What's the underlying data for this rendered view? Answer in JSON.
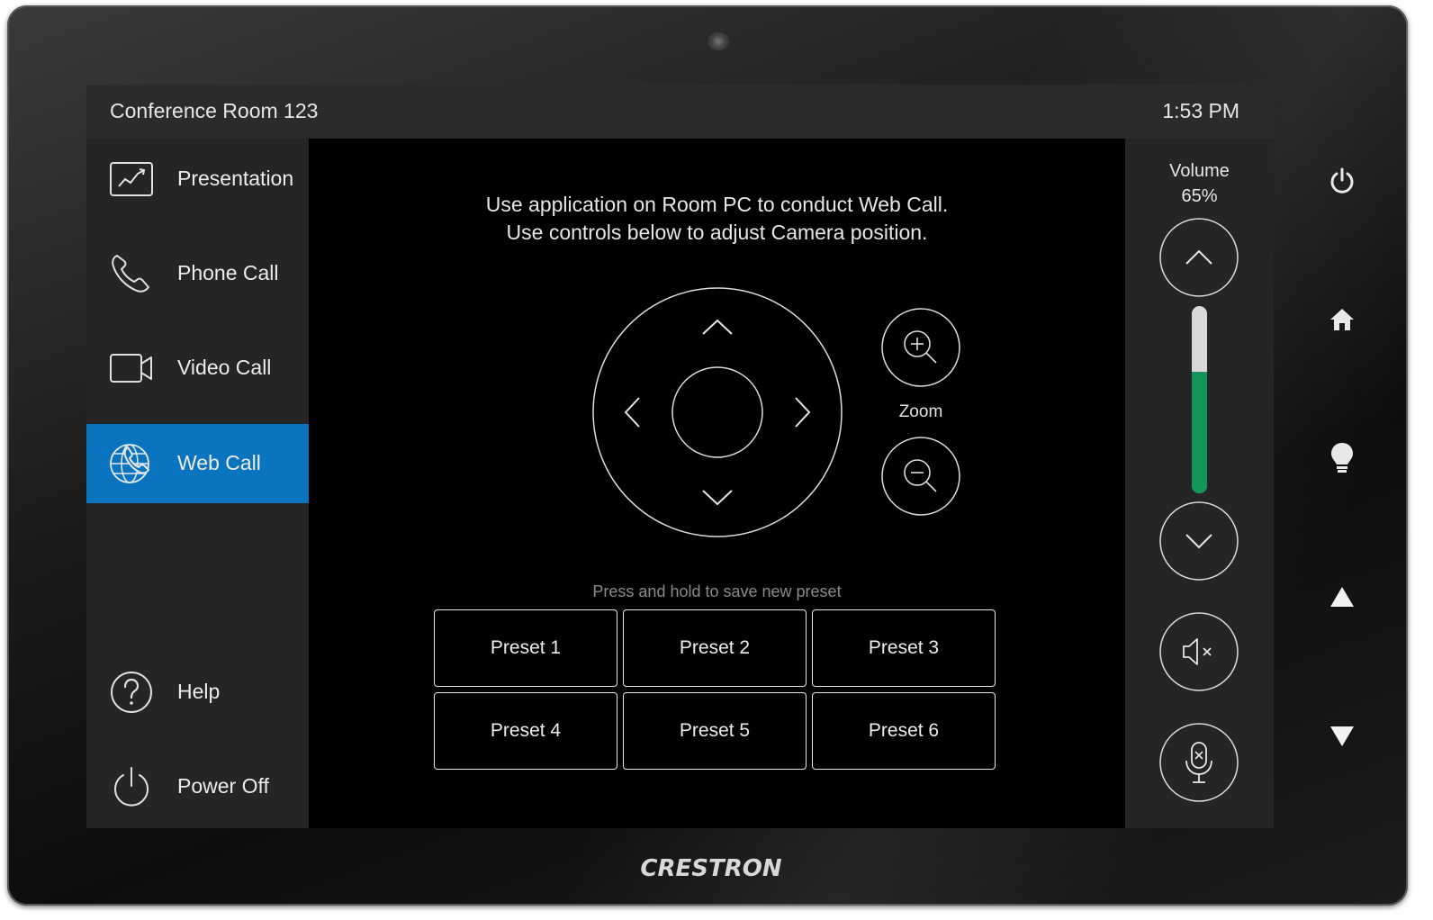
{
  "device": {
    "brand": "CRESTRON"
  },
  "header": {
    "room_name": "Conference Room 123",
    "time": "1:53 PM"
  },
  "sidebar": {
    "items": [
      {
        "label": "Presentation",
        "icon": "presentation-chart-icon",
        "active": false
      },
      {
        "label": "Phone Call",
        "icon": "phone-icon",
        "active": false
      },
      {
        "label": "Video Call",
        "icon": "video-camera-icon",
        "active": false
      },
      {
        "label": "Web Call",
        "icon": "globe-phone-icon",
        "active": true
      },
      {
        "label": "Help",
        "icon": "question-icon",
        "active": false
      },
      {
        "label": "Power Off",
        "icon": "power-icon",
        "active": false
      }
    ]
  },
  "main": {
    "instructions_line1": "Use application on Room PC to conduct Web Call.",
    "instructions_line2": "Use controls below to adjust Camera position.",
    "zoom_label": "Zoom",
    "preset_hint": "Press and hold to save new preset",
    "presets": [
      "Preset 1",
      "Preset 2",
      "Preset 3",
      "Preset 4",
      "Preset 5",
      "Preset 6"
    ]
  },
  "volume": {
    "title": "Volume",
    "percent_text": "65%",
    "level": 0.65,
    "fill_color": "#14955a",
    "track_color": "#d9d9d9"
  },
  "colors": {
    "active_nav": "#0a74be",
    "panel_bg": "#252525",
    "topbar_bg": "#2b2b2b"
  },
  "hardware_buttons": [
    "power-icon",
    "home-icon",
    "light-bulb-icon",
    "arrow-up-icon",
    "arrow-down-icon"
  ]
}
